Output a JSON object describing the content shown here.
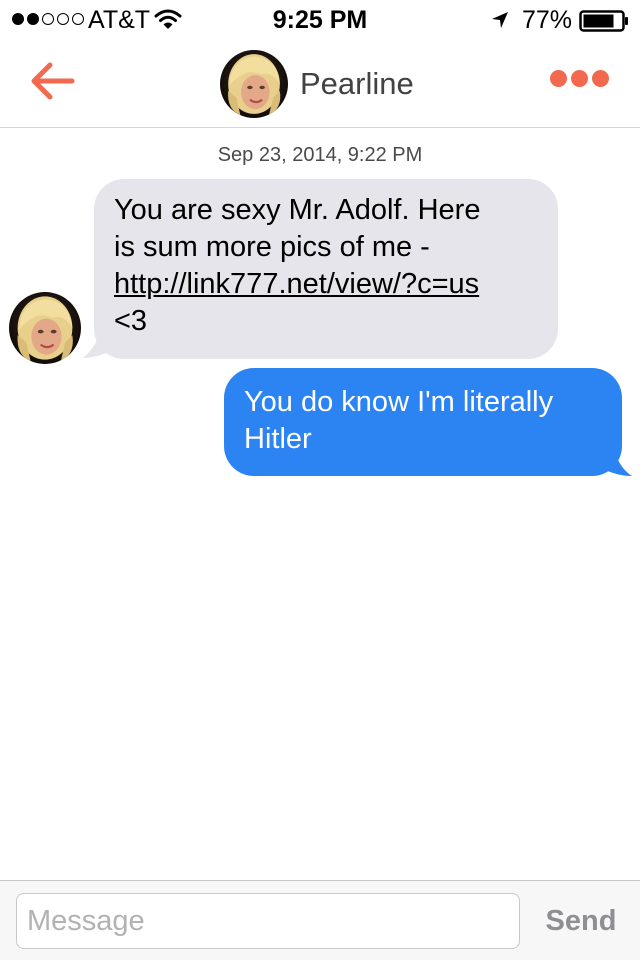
{
  "status_bar": {
    "carrier": "AT&T",
    "signal_bars_filled": 2,
    "signal_bars_total": 5,
    "time": "9:25 PM",
    "battery_percent": "77%",
    "icons": [
      "wifi-icon",
      "location-arrow-icon",
      "battery-icon"
    ]
  },
  "header": {
    "back_icon": "arrow-left-icon",
    "contact_name": "Pearline",
    "more_icon": "more-dots-icon"
  },
  "conversation": {
    "timestamp": "Sep 23, 2014, 9:22 PM",
    "incoming": {
      "line1": "You are sexy Mr. Adolf. Here",
      "line2": "is sum more pics of me -",
      "link": "http://link777.net/view/?c=us",
      "line4": "<3"
    },
    "outgoing": {
      "line1": "You do know I'm literally",
      "line2": "Hitler"
    }
  },
  "composer": {
    "placeholder": "Message",
    "value": "",
    "send_label": "Send"
  },
  "colors": {
    "accent": "#f2694f",
    "outgoing_bubble": "#2b84f2",
    "incoming_bubble": "#e6e5eb",
    "send_disabled": "#8e8e93"
  }
}
